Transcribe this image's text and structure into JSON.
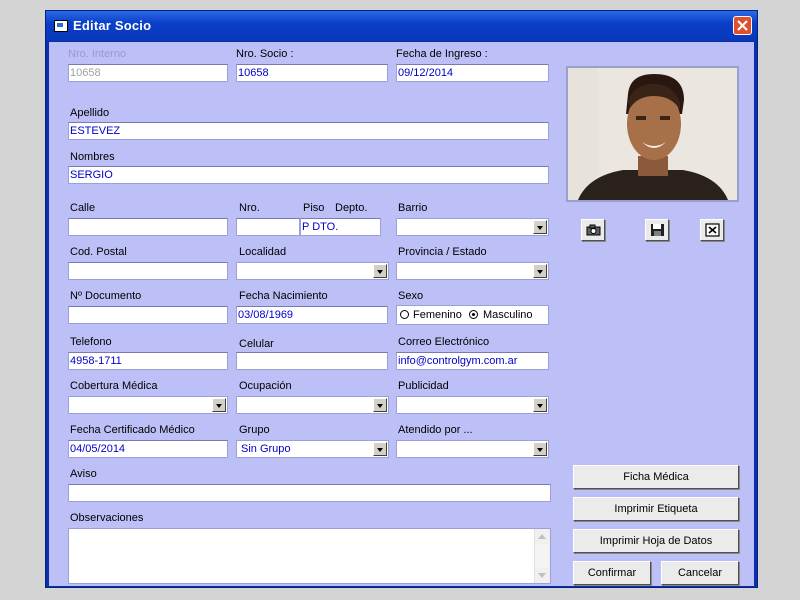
{
  "window": {
    "title": "Editar Socio"
  },
  "fields": {
    "nro_interno": {
      "label": "Nro. Interno",
      "value": "10658"
    },
    "nro_socio": {
      "label": "Nro. Socio :",
      "value": "10658"
    },
    "fecha_ingreso": {
      "label": "Fecha de Ingreso :",
      "value": "09/12/2014"
    },
    "apellido": {
      "label": "Apellido",
      "value": "ESTEVEZ"
    },
    "nombres": {
      "label": "Nombres",
      "value": "SERGIO"
    },
    "calle": {
      "label": "Calle",
      "value": ""
    },
    "nro": {
      "label": "Nro.",
      "value": ""
    },
    "piso": {
      "label": "Piso",
      "value": "P DTO."
    },
    "depto": {
      "label": "Depto."
    },
    "barrio": {
      "label": "Barrio",
      "value": ""
    },
    "cod_postal": {
      "label": "Cod. Postal",
      "value": ""
    },
    "localidad": {
      "label": "Localidad",
      "value": ""
    },
    "provincia": {
      "label": "Provincia / Estado",
      "value": ""
    },
    "documento": {
      "label": "Nº Documento",
      "value": ""
    },
    "fecha_nacimiento": {
      "label": "Fecha Nacimiento",
      "value": "03/08/1969"
    },
    "sexo": {
      "label": "Sexo",
      "options": [
        "Femenino",
        "Masculino"
      ],
      "selected": "Masculino"
    },
    "telefono": {
      "label": "Telefono",
      "value": "4958-1711"
    },
    "celular": {
      "label": "Celular",
      "value": ""
    },
    "correo": {
      "label": "Correo Electrónico",
      "value": "info@controlgym.com.ar"
    },
    "cobertura": {
      "label": "Cobertura Médica",
      "value": ""
    },
    "ocupacion": {
      "label": "Ocupación",
      "value": ""
    },
    "publicidad": {
      "label": "Publicidad",
      "value": ""
    },
    "fecha_cert": {
      "label": "Fecha Certificado Médico",
      "value": "04/05/2014"
    },
    "grupo": {
      "label": "Grupo",
      "value": "Sin Grupo"
    },
    "atendido": {
      "label": "Atendido por ...",
      "value": ""
    },
    "aviso": {
      "label": "Aviso",
      "value": ""
    },
    "observaciones": {
      "label": "Observaciones",
      "value": ""
    }
  },
  "buttons": {
    "ficha_medica": "Ficha Médica",
    "imprimir_etiqueta": "Imprimir Etiqueta",
    "imprimir_hoja": "Imprimir Hoja de Datos",
    "confirmar": "Confirmar",
    "cancelar": "Cancelar"
  },
  "photo_tools": [
    "camera-icon",
    "save-icon",
    "delete-icon"
  ],
  "colors": {
    "titlebar": "#0a3fc8",
    "client_bg": "#bdc0f7",
    "value_text": "#0000c8",
    "close": "#e05030"
  }
}
